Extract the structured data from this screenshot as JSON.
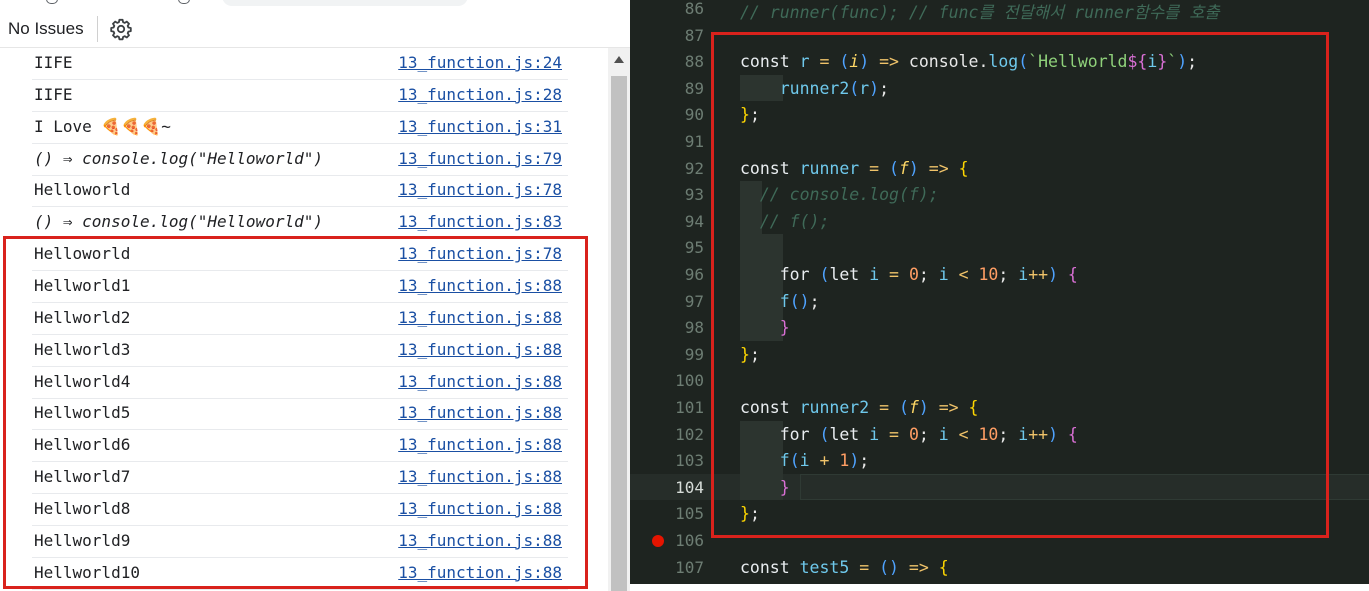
{
  "console": {
    "toolbar": {
      "issues_label": "No Issues",
      "settings_icon": "gear-icon"
    },
    "logs": [
      {
        "message": "IIFE",
        "source": "13_function.js:24",
        "italic": false
      },
      {
        "message": "IIFE",
        "source": "13_function.js:28",
        "italic": false
      },
      {
        "message": "I Love 🍕🍕🍕~",
        "source": "13_function.js:31",
        "italic": false
      },
      {
        "message": "() ⇒ console.log(\"Helloworld\")",
        "source": "13_function.js:79",
        "italic": true
      },
      {
        "message": "Helloworld",
        "source": "13_function.js:78",
        "italic": false
      },
      {
        "message": "() ⇒ console.log(\"Helloworld\")",
        "source": "13_function.js:83",
        "italic": true
      },
      {
        "message": "Helloworld",
        "source": "13_function.js:78",
        "italic": false
      },
      {
        "message": "Hellworld1",
        "source": "13_function.js:88",
        "italic": false
      },
      {
        "message": "Hellworld2",
        "source": "13_function.js:88",
        "italic": false
      },
      {
        "message": "Hellworld3",
        "source": "13_function.js:88",
        "italic": false
      },
      {
        "message": "Hellworld4",
        "source": "13_function.js:88",
        "italic": false
      },
      {
        "message": "Hellworld5",
        "source": "13_function.js:88",
        "italic": false
      },
      {
        "message": "Hellworld6",
        "source": "13_function.js:88",
        "italic": false
      },
      {
        "message": "Hellworld7",
        "source": "13_function.js:88",
        "italic": false
      },
      {
        "message": "Hellworld8",
        "source": "13_function.js:88",
        "italic": false
      },
      {
        "message": "Hellworld9",
        "source": "13_function.js:88",
        "italic": false
      },
      {
        "message": "Hellworld10",
        "source": "13_function.js:88",
        "italic": false
      }
    ]
  },
  "editor": {
    "current_line": 104,
    "breakpoint_line": 106,
    "lines": [
      {
        "n": 86,
        "tokens": [
          [
            "cmt",
            "// runner(func); // func를 전달해서 runner함수를 호출"
          ]
        ]
      },
      {
        "n": 87,
        "tokens": []
      },
      {
        "n": 88,
        "tokens": [
          [
            "kw",
            "const "
          ],
          [
            "fn",
            "r"
          ],
          [
            "op",
            " = "
          ],
          [
            "paren",
            "("
          ],
          [
            "par",
            "i"
          ],
          [
            "paren",
            ")"
          ],
          [
            "op",
            " => "
          ],
          [
            "plain",
            "console."
          ],
          [
            "fn",
            "log"
          ],
          [
            "paren",
            "("
          ],
          [
            "str",
            "`Hellworld"
          ],
          [
            "brace2",
            "${"
          ],
          [
            "fn",
            "i"
          ],
          [
            "brace2",
            "}"
          ],
          [
            "str",
            "`"
          ],
          [
            "paren",
            ")"
          ],
          [
            "plain",
            ";"
          ]
        ]
      },
      {
        "n": 89,
        "tokens": [
          [
            "plain",
            "    "
          ],
          [
            "fn",
            "runner2"
          ],
          [
            "paren",
            "("
          ],
          [
            "fn",
            "r"
          ],
          [
            "paren",
            ")"
          ],
          [
            "plain",
            ";"
          ]
        ]
      },
      {
        "n": 90,
        "tokens": [
          [
            "brace",
            "}"
          ],
          [
            "plain",
            ";"
          ]
        ]
      },
      {
        "n": 91,
        "tokens": []
      },
      {
        "n": 92,
        "tokens": [
          [
            "kw",
            "const "
          ],
          [
            "fn",
            "runner"
          ],
          [
            "op",
            " = "
          ],
          [
            "paren",
            "("
          ],
          [
            "par",
            "f"
          ],
          [
            "paren",
            ")"
          ],
          [
            "op",
            " => "
          ],
          [
            "brace",
            "{"
          ]
        ]
      },
      {
        "n": 93,
        "tokens": [
          [
            "cmt",
            "  // console.log(f);"
          ]
        ]
      },
      {
        "n": 94,
        "tokens": [
          [
            "cmt",
            "  // f();"
          ]
        ]
      },
      {
        "n": 95,
        "tokens": []
      },
      {
        "n": 96,
        "tokens": [
          [
            "plain",
            "    "
          ],
          [
            "kw",
            "for "
          ],
          [
            "paren",
            "("
          ],
          [
            "kw",
            "let "
          ],
          [
            "fn",
            "i"
          ],
          [
            "op",
            " = "
          ],
          [
            "num",
            "0"
          ],
          [
            "plain",
            "; "
          ],
          [
            "fn",
            "i"
          ],
          [
            "op",
            " < "
          ],
          [
            "num",
            "10"
          ],
          [
            "plain",
            "; "
          ],
          [
            "fn",
            "i"
          ],
          [
            "op",
            "++"
          ],
          [
            "paren",
            ")"
          ],
          [
            "brace2",
            " {"
          ]
        ]
      },
      {
        "n": 97,
        "tokens": [
          [
            "plain",
            "    "
          ],
          [
            "fn",
            "f"
          ],
          [
            "paren",
            "()"
          ],
          [
            "plain",
            ";"
          ]
        ]
      },
      {
        "n": 98,
        "tokens": [
          [
            "plain",
            "    "
          ],
          [
            "brace2",
            "}"
          ]
        ]
      },
      {
        "n": 99,
        "tokens": [
          [
            "brace",
            "}"
          ],
          [
            "plain",
            ";"
          ]
        ]
      },
      {
        "n": 100,
        "tokens": []
      },
      {
        "n": 101,
        "tokens": [
          [
            "kw",
            "const "
          ],
          [
            "fn",
            "runner2"
          ],
          [
            "op",
            " = "
          ],
          [
            "paren",
            "("
          ],
          [
            "par",
            "f"
          ],
          [
            "paren",
            ")"
          ],
          [
            "op",
            " => "
          ],
          [
            "brace",
            "{"
          ]
        ]
      },
      {
        "n": 102,
        "tokens": [
          [
            "plain",
            "    "
          ],
          [
            "kw",
            "for "
          ],
          [
            "paren",
            "("
          ],
          [
            "kw",
            "let "
          ],
          [
            "fn",
            "i"
          ],
          [
            "op",
            " = "
          ],
          [
            "num",
            "0"
          ],
          [
            "plain",
            "; "
          ],
          [
            "fn",
            "i"
          ],
          [
            "op",
            " < "
          ],
          [
            "num",
            "10"
          ],
          [
            "plain",
            "; "
          ],
          [
            "fn",
            "i"
          ],
          [
            "op",
            "++"
          ],
          [
            "paren",
            ")"
          ],
          [
            "brace2",
            " {"
          ]
        ]
      },
      {
        "n": 103,
        "tokens": [
          [
            "plain",
            "    "
          ],
          [
            "fn",
            "f"
          ],
          [
            "paren",
            "("
          ],
          [
            "fn",
            "i"
          ],
          [
            "op",
            " + "
          ],
          [
            "num",
            "1"
          ],
          [
            "paren",
            ")"
          ],
          [
            "plain",
            ";"
          ]
        ]
      },
      {
        "n": 104,
        "tokens": [
          [
            "plain",
            "    "
          ],
          [
            "brace2",
            "}"
          ]
        ]
      },
      {
        "n": 105,
        "tokens": [
          [
            "brace",
            "}"
          ],
          [
            "plain",
            ";"
          ]
        ]
      },
      {
        "n": 106,
        "tokens": []
      },
      {
        "n": 107,
        "tokens": [
          [
            "kw",
            "const "
          ],
          [
            "fn",
            "test5"
          ],
          [
            "op",
            " = "
          ],
          [
            "paren",
            "()"
          ],
          [
            "op",
            " => "
          ],
          [
            "brace",
            "{"
          ]
        ]
      }
    ]
  }
}
